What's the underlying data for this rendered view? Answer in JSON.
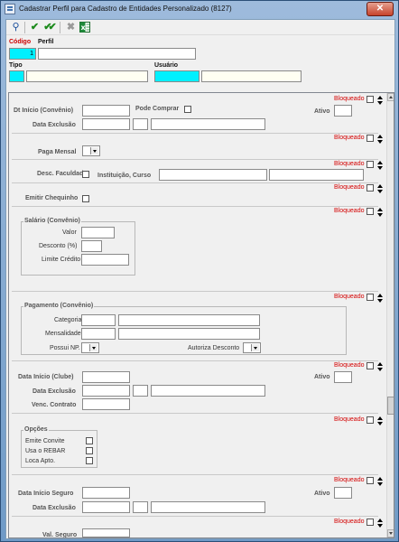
{
  "window": {
    "title": "Cadastrar Perfil para Cadastro de Entidades Personalizado (8127)",
    "close_label": "✕"
  },
  "toolbar": {
    "icons": [
      "search-icon",
      "check-icon",
      "check-all-icon",
      "cancel-icon",
      "excel-icon"
    ]
  },
  "header": {
    "codigo_label": "Código",
    "codigo_value": "1",
    "perfil_label": "Perfil",
    "perfil_value": "",
    "tipo_label": "Tipo",
    "tipo_value": "",
    "usuario_label": "Usuário",
    "usuario_value": ""
  },
  "bloqueado_label": "Bloqueado",
  "convenio": {
    "dt_inicio_label": "Dt Início (Convênio)",
    "pode_comprar_label": "Pode Comprar",
    "ativo_label": "Ativo",
    "data_exclusao_label": "Data Exclusão"
  },
  "paga_mensal_label": "Paga Mensal",
  "desc_faculdade_label": "Desc. Faculdade",
  "instituicao_curso_label": "Instituição, Curso",
  "emitir_chequinho_label": "Emitir Chequinho",
  "salario": {
    "title": "Salário (Convênio)",
    "valor_label": "Valor",
    "desconto_label": "Desconto (%)",
    "limite_credito_label": "Limite Crédito"
  },
  "pagamento": {
    "title": "Pagamento (Convênio)",
    "categoria_label": "Categoria",
    "mensalidade_label": "Mensalidade",
    "possui_np_label": "Possui NP.",
    "autoriza_desconto_label": "Autoriza Desconto"
  },
  "clube": {
    "data_inicio_label": "Data Início (Clube)",
    "ativo_label": "Ativo",
    "data_exclusao_label": "Data Exclusão",
    "venc_contrato_label": "Venc. Contrato"
  },
  "opcoes": {
    "title": "Opções",
    "items": [
      "Emite Convite",
      "Usa o REBAR",
      "Loca Apto."
    ]
  },
  "seguro": {
    "data_inicio_label": "Data Início Seguro",
    "ativo_label": "Ativo",
    "data_exclusao_label": "Data Exclusão",
    "val_seguro_label": "Val. Seguro"
  }
}
